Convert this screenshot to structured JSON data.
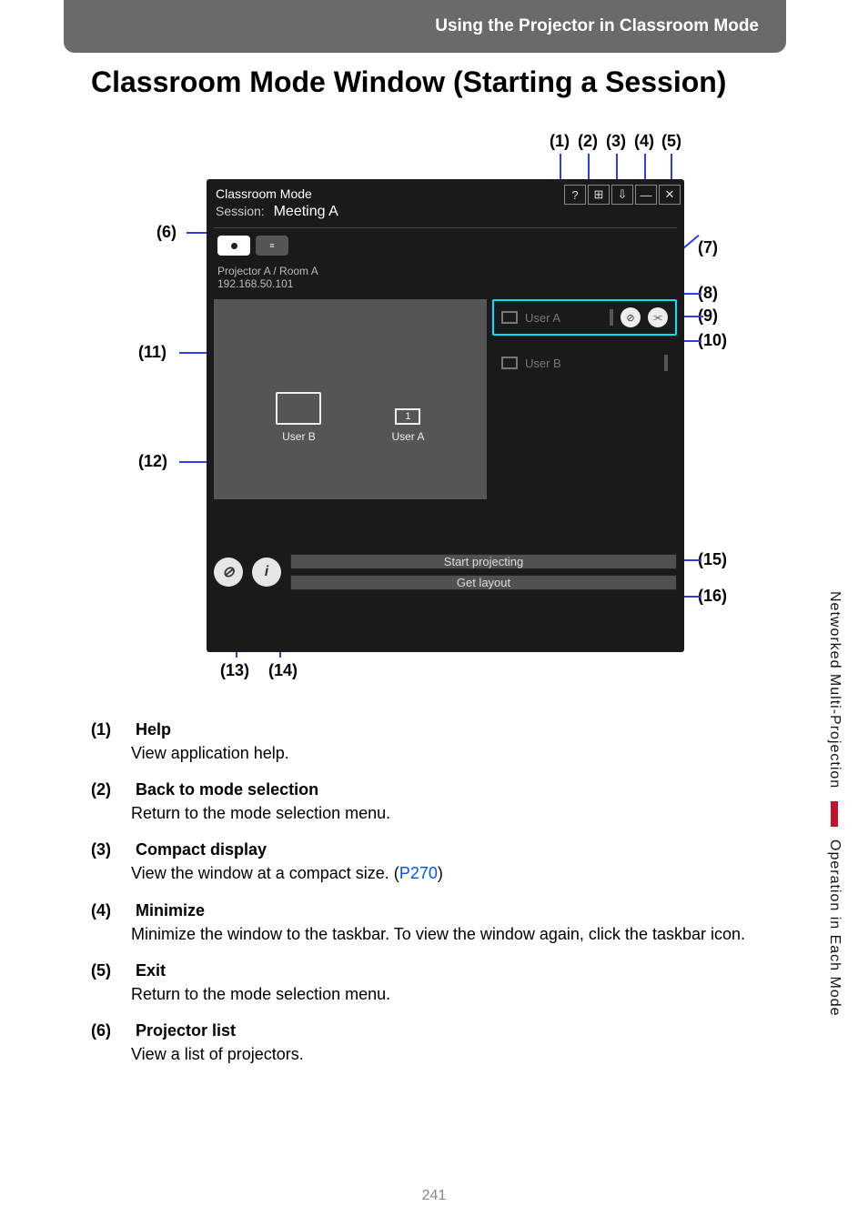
{
  "header": {
    "text": "Using the Projector in Classroom Mode"
  },
  "title": "Classroom Mode Window (Starting a Session)",
  "callouts": {
    "c1": "(1)",
    "c2": "(2)",
    "c3": "(3)",
    "c4": "(4)",
    "c5": "(5)",
    "c6": "(6)",
    "c7": "(7)",
    "c8": "(8)",
    "c9": "(9)",
    "c10": "(10)",
    "c11": "(11)",
    "c12": "(12)",
    "c13": "(13)",
    "c14": "(14)",
    "c15": "(15)",
    "c16": "(16)"
  },
  "app": {
    "mode_label": "Classroom Mode",
    "session_prefix": "Session:",
    "session_name": "Meeting A",
    "projector": {
      "name": "Projector A / Room A",
      "ip": "192.168.50.101"
    },
    "layout": {
      "slot1": "User B",
      "slot2_index": "1",
      "slot2_label": "User A"
    },
    "users": [
      {
        "name": "User A"
      },
      {
        "name": "User B"
      }
    ],
    "buttons": {
      "start": "Start projecting",
      "getlayout": "Get layout"
    },
    "icons": {
      "help": "?",
      "grid": "⊞",
      "compact": "⇩",
      "minimize": "—",
      "close": "✕",
      "info": "i",
      "block": "⊘",
      "connect": "⫘"
    }
  },
  "descriptions": [
    {
      "num": "(1)",
      "title": "Help",
      "body": "View application help."
    },
    {
      "num": "(2)",
      "title": "Back to mode selection",
      "body": "Return to the mode selection menu."
    },
    {
      "num": "(3)",
      "title": "Compact display",
      "body": "View the window at a compact size. (",
      "link": "P270",
      "body2": ")"
    },
    {
      "num": "(4)",
      "title": "Minimize",
      "body": "Minimize the window to the taskbar. To view the window again, click the taskbar icon."
    },
    {
      "num": "(5)",
      "title": "Exit",
      "body": "Return to the mode selection menu."
    },
    {
      "num": "(6)",
      "title": "Projector list",
      "body": "View a list of projectors."
    }
  ],
  "sidebar": {
    "top": "Networked Multi-Projection",
    "bottom": "Operation in Each Mode"
  },
  "page_number": "241"
}
